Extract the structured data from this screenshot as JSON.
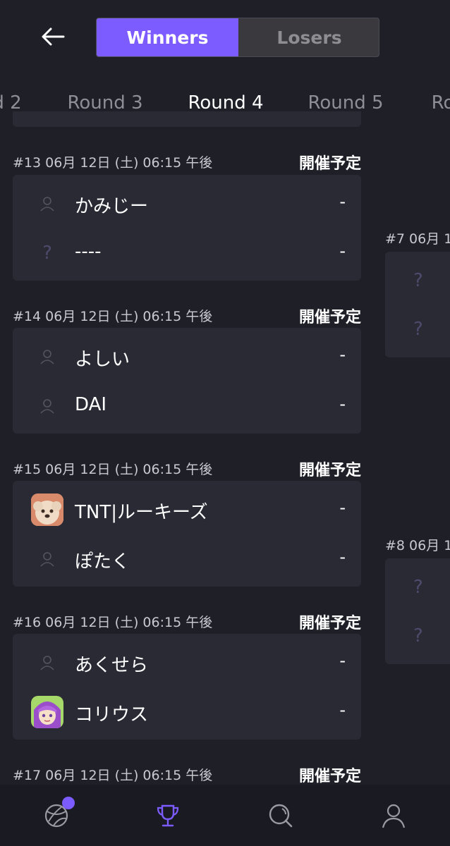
{
  "header": {
    "tabs": [
      {
        "label": "Winners",
        "active": true
      },
      {
        "label": "Losers",
        "active": false
      }
    ]
  },
  "rounds": [
    {
      "label": "d 2"
    },
    {
      "label": "Round 3"
    },
    {
      "label": "Round 4",
      "active": true
    },
    {
      "label": "Round 5"
    },
    {
      "label": "Ro"
    }
  ],
  "matches": [
    {
      "info": "#13 06月 12日 (土) 06:15 午後",
      "status": "開催予定",
      "players": [
        {
          "name": "かみじー",
          "score": "-",
          "icon": "user-icon"
        },
        {
          "name": "----",
          "score": "-",
          "icon": "question-icon"
        }
      ]
    },
    {
      "info": "#14 06月 12日 (土) 06:15 午後",
      "status": "開催予定",
      "players": [
        {
          "name": "よしい",
          "score": "-",
          "icon": "user-icon"
        },
        {
          "name": "DAI",
          "score": "-",
          "icon": "user-icon"
        }
      ]
    },
    {
      "info": "#15 06月 12日 (土) 06:15 午後",
      "status": "開催予定",
      "players": [
        {
          "name": "TNT|ルーキーズ",
          "score": "-",
          "icon": "avatar-dog"
        },
        {
          "name": "ぽたく",
          "score": "-",
          "icon": "user-icon"
        }
      ]
    },
    {
      "info": "#16 06月 12日 (土) 06:15 午後",
      "status": "開催予定",
      "players": [
        {
          "name": "あくせら",
          "score": "-",
          "icon": "user-icon"
        },
        {
          "name": "コリウス",
          "score": "-",
          "icon": "avatar-anime"
        }
      ]
    },
    {
      "info": "#17 06月 12日 (土) 06:15 午後",
      "status": "開催予定",
      "players": []
    }
  ],
  "next_round": [
    {
      "info": "#7 06月 12",
      "q1": "?",
      "q2": "?"
    },
    {
      "info": "#8 06月 12",
      "q1": "?",
      "q2": "?"
    }
  ],
  "nav": {
    "items": [
      {
        "icon": "ball-icon"
      },
      {
        "icon": "trophy-icon",
        "active": true
      },
      {
        "icon": "search-icon"
      },
      {
        "icon": "profile-icon"
      }
    ]
  },
  "colors": {
    "accent": "#7c5cff",
    "background": "#1f1f28",
    "card": "#2a2a35"
  }
}
